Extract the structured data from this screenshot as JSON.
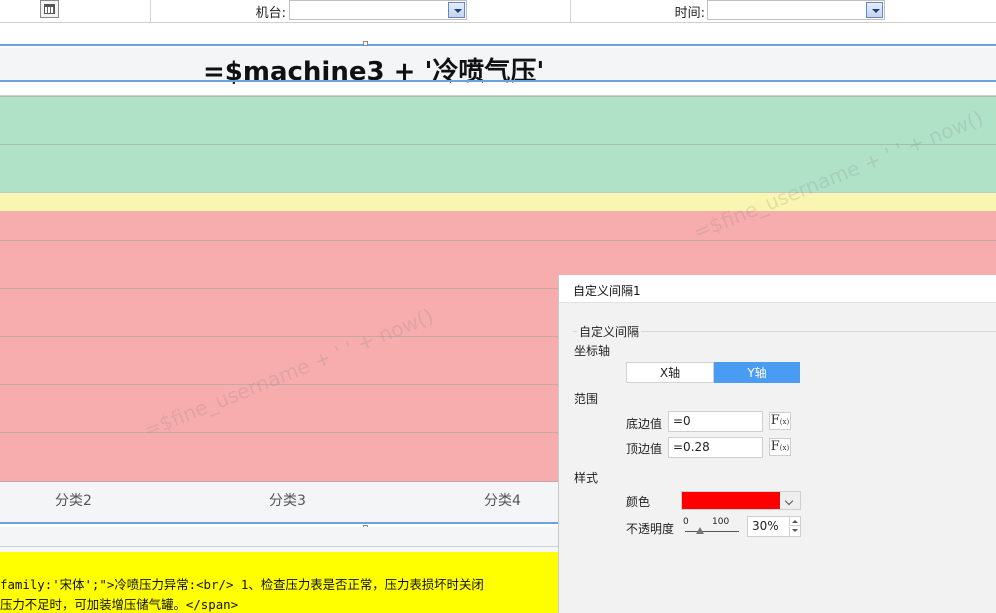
{
  "filters": {
    "machine_label": "机台:",
    "machine_value": "",
    "time_label": "时间:",
    "time_value": ""
  },
  "title_expression": "=$machine3 + '冷喷气压'",
  "chart": {
    "bands": [
      {
        "name": "green",
        "color": "#b0e2c8"
      },
      {
        "name": "yellow",
        "color": "#f8f6b0"
      },
      {
        "name": "red",
        "color": "#f7adae"
      }
    ],
    "categories": [
      "分类2",
      "分类3",
      "分类4"
    ],
    "watermark": "=$fine_username + ' ' + now()"
  },
  "bottom_text": {
    "line1": "family:'宋体';\">冷喷压力异常:<br/> 1、检查压力表是否正常，压力表损坏时关闭",
    "line2": "压力不足时，可加装增压储气罐。</span>"
  },
  "dialog": {
    "title": "自定义间隔1",
    "group_title": "自定义间隔",
    "axis_label": "坐标轴",
    "x_axis_label": "X轴",
    "y_axis_label": "Y轴",
    "selected_axis": "Y轴",
    "range_label": "范围",
    "bottom_label": "底边值",
    "bottom_value": "=0",
    "top_label": "顶边值",
    "top_value": "=0.28",
    "fx_label": "F",
    "fx_sub": "(x)",
    "style_label": "样式",
    "color_label": "颜色",
    "color_value": "#ff0000",
    "opacity_label": "不透明度",
    "opacity_min": "0",
    "opacity_max": "100",
    "opacity_value": "30%"
  }
}
